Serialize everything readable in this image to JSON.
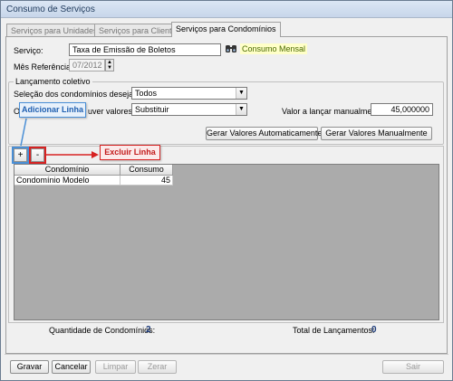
{
  "window": {
    "title": "Consumo de Serviços"
  },
  "tabs": [
    {
      "label": "Serviços para Unidades"
    },
    {
      "label": "Serviços para Clientes"
    },
    {
      "label": "Serviços para Condomínios"
    }
  ],
  "form": {
    "servico_label": "Serviço:",
    "servico_value": "Taxa de Emissão de Boletos",
    "consumo_tag": "Consumo Mensal",
    "mes_label": "Mês Referência:",
    "mes_value": "07/2012"
  },
  "lancamento": {
    "group_title": "Lançamento coletivo",
    "selecao_label": "Seleção dos condomínios desejados:",
    "selecao_value": "Todos",
    "valores_label_start": "O",
    "valores_label_end": "uver valores?",
    "valores_value": "Substituir",
    "manual_label": "Valor a lançar manualmente:",
    "manual_value": "45,000000",
    "btn_auto": "Gerar Valores Automaticamente",
    "btn_manual": "Gerar Valores Manualmente"
  },
  "grid": {
    "add_label": "+",
    "remove_label": "-",
    "columns": [
      "Condomínio",
      "Consumo"
    ],
    "rows": [
      {
        "condominio": "Condomínio Modelo",
        "consumo": "45"
      }
    ]
  },
  "annotations": {
    "add_callout": "Adicionar Linha",
    "remove_callout": "Excluir Linha",
    "add_color": "#4a8fd6",
    "remove_color": "#d72222"
  },
  "footer": {
    "qtd_label": "Quantidade de Condomínios:",
    "qtd_value": "2",
    "total_label": "Total de Lançamentos:",
    "total_value": "0"
  },
  "actions": {
    "gravar": "Gravar",
    "cancelar": "Cancelar",
    "limpar": "Limpar",
    "zerar": "Zerar",
    "sair": "Sair"
  }
}
